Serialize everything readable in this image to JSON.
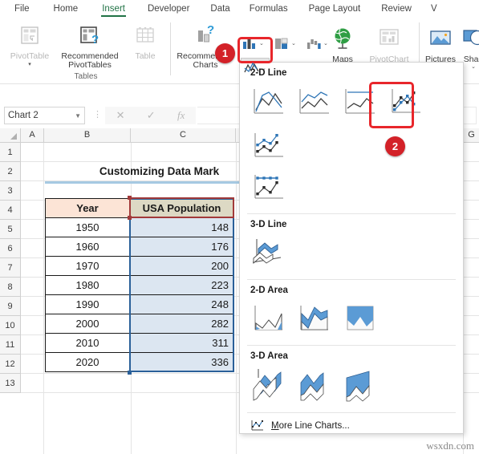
{
  "ribbon": {
    "tabs": [
      {
        "label": "File",
        "active": false
      },
      {
        "label": "Home",
        "active": false
      },
      {
        "label": "Insert",
        "active": true
      },
      {
        "label": "Developer",
        "active": false
      },
      {
        "label": "Data",
        "active": false
      },
      {
        "label": "Formulas",
        "active": false
      },
      {
        "label": "Page Layout",
        "active": false
      },
      {
        "label": "Review",
        "active": false
      },
      {
        "label": "V",
        "active": false
      }
    ],
    "groups": [
      {
        "label": "Tables"
      }
    ],
    "buttons": {
      "pivot_table": "PivotTable",
      "recommended_pivot_tables_l1": "Recommended",
      "recommended_pivot_tables_l2": "PivotTables",
      "table": "Table",
      "recommended_charts_l1": "Recommended",
      "recommended_charts_l2": "Charts",
      "maps": "Maps",
      "pivot_chart": "PivotChart",
      "pictures": "Pictures",
      "shapes": "Shap"
    },
    "icons": {
      "pivot_table": "pivot-table-icon",
      "recommended_pivot_tables": "recommended-pivottables-icon",
      "table": "table-icon",
      "recommended_charts": "recommended-charts-icon",
      "column_chart": "column-chart-icon",
      "hierarchy_chart": "hierarchy-chart-icon",
      "waterfall_chart": "waterfall-chart-icon",
      "line_chart": "line-chart-icon",
      "bar_chart": "bar-chart-icon",
      "combo_chart": "combo-chart-icon",
      "maps": "globe-icon",
      "pivot_chart": "pivotchart-icon",
      "pictures": "pictures-icon",
      "shapes": "shapes-icon"
    }
  },
  "annotations": {
    "step1": "1",
    "step2": "2"
  },
  "formula_bar": {
    "name_box_value": "Chart 2",
    "cancel_icon": "cancel-icon",
    "confirm_icon": "confirm-icon",
    "function_icon": "insert-function-icon",
    "formula_value": ""
  },
  "grid": {
    "columns": [
      "A",
      "B",
      "C",
      "G"
    ],
    "rows": [
      "1",
      "2",
      "3",
      "4",
      "5",
      "6",
      "7",
      "8",
      "9",
      "10",
      "11",
      "12",
      "13"
    ],
    "sheet_title": "Customizing Data Mark",
    "table": {
      "headers": [
        "Year",
        "USA Population"
      ],
      "rows": [
        [
          "1950",
          "148"
        ],
        [
          "1960",
          "176"
        ],
        [
          "1970",
          "200"
        ],
        [
          "1980",
          "223"
        ],
        [
          "1990",
          "248"
        ],
        [
          "2000",
          "282"
        ],
        [
          "2010",
          "311"
        ],
        [
          "2020",
          "336"
        ]
      ]
    }
  },
  "gallery": {
    "sections": [
      {
        "title": "2-D Line",
        "items": [
          {
            "name": "line",
            "selected": false
          },
          {
            "name": "stacked-line",
            "selected": false
          },
          {
            "name": "100-percent-stacked-line",
            "selected": false
          },
          {
            "name": "line-with-markers",
            "selected": true
          },
          {
            "name": "stacked-line-with-markers",
            "selected": false
          },
          {
            "name": "100-percent-stacked-line-with-markers",
            "selected": false
          }
        ]
      },
      {
        "title": "3-D Line",
        "items": [
          {
            "name": "3d-line",
            "selected": false
          }
        ]
      },
      {
        "title": "2-D Area",
        "items": [
          {
            "name": "area",
            "selected": false
          },
          {
            "name": "stacked-area",
            "selected": false
          },
          {
            "name": "100-percent-stacked-area",
            "selected": false
          }
        ]
      },
      {
        "title": "3-D Area",
        "items": [
          {
            "name": "3d-area",
            "selected": false
          },
          {
            "name": "3d-stacked-area",
            "selected": false
          },
          {
            "name": "3d-100-percent-stacked-area",
            "selected": false
          }
        ]
      }
    ],
    "more_label_prefix": "M",
    "more_label_rest": "ore Line Charts...",
    "more_icon": "more-line-charts-icon"
  },
  "watermark": "wsxdn.com",
  "colors": {
    "accent_green": "#217346",
    "annotation_red": "#e8262b",
    "chart_blue": "#2e75b6",
    "chart_dark": "#3b3b3b",
    "header_year_bg": "#fce4d6",
    "header_pop_bg": "#ddd9c4",
    "data_pop_bg": "#dce6f1",
    "selection_blue": "#2a6099"
  }
}
